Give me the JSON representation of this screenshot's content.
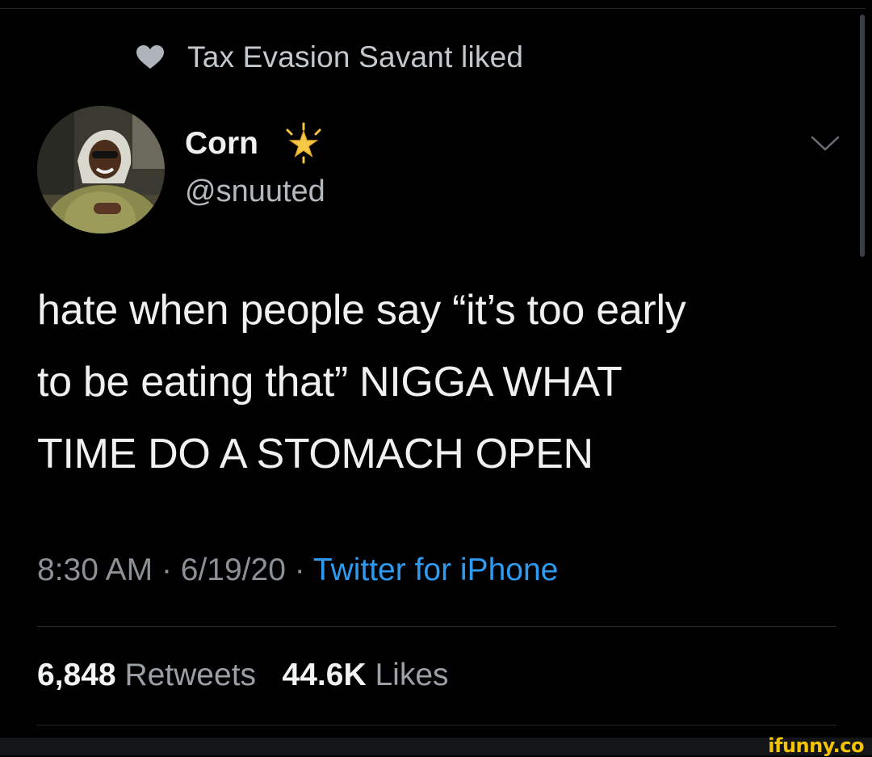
{
  "social_context": {
    "liked_by_text": "Tax Evasion Savant liked",
    "icon": "heart-icon"
  },
  "author": {
    "name": "Corn",
    "name_badge_icon": "glowing-star-icon",
    "handle": "@snuuted",
    "avatar_icon": "profile-photo"
  },
  "menu": {
    "icon": "chevron-down-icon"
  },
  "tweet": {
    "text_lines": [
      "hate when people say “it’s too early",
      "to be eating that” NIGGA WHAT",
      "TIME DO A STOMACH OPEN"
    ],
    "time": "8:30 AM",
    "separator": "·",
    "date": "6/19/20",
    "source": "Twitter for iPhone"
  },
  "stats": {
    "retweets_count": "6,848",
    "retweets_label": "Retweets",
    "likes_count": "44.6K",
    "likes_label": "Likes"
  },
  "watermark": {
    "text": "ifunny.co"
  },
  "colors": {
    "background": "#000000",
    "link_blue": "#2e9bf0",
    "watermark_yellow": "#f5c400"
  }
}
